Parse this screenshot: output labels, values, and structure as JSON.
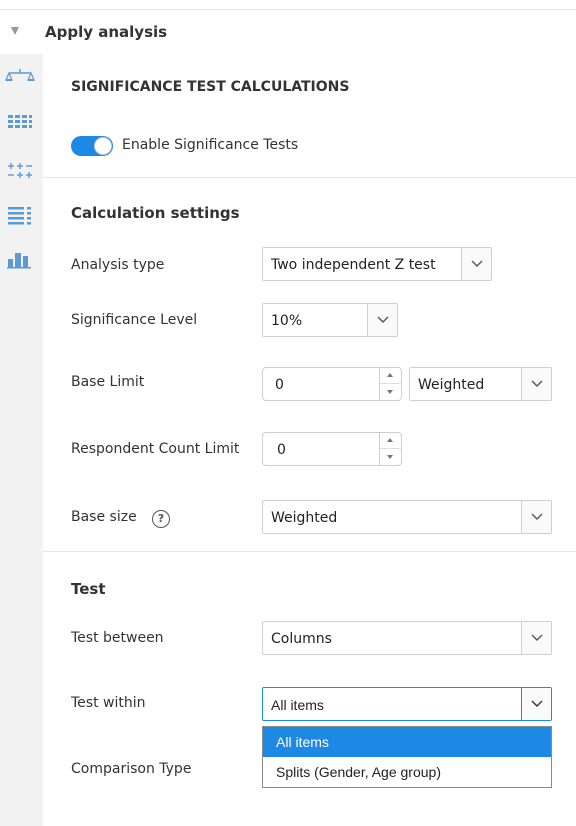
{
  "header": {
    "title": "Apply analysis"
  },
  "rail": {
    "icons": [
      "scale-icon",
      "grid-table-icon",
      "plus-minus-icon",
      "list-icon",
      "bar-chart-icon"
    ]
  },
  "panel": {
    "section_title": "SIGNIFICANCE TEST CALCULATIONS",
    "toggle": {
      "label": "Enable Significance Tests",
      "on": true
    },
    "calc": {
      "title": "Calculation settings",
      "analysis_type": {
        "label": "Analysis type",
        "value": "Two independent Z test"
      },
      "significance_level": {
        "label": "Significance Level",
        "value": "10%"
      },
      "base_limit": {
        "label": "Base Limit",
        "value": "0",
        "weight": "Weighted"
      },
      "respondent_count_limit": {
        "label": "Respondent Count Limit",
        "value": "0"
      },
      "base_size": {
        "label": "Base size",
        "help": "?",
        "value": "Weighted"
      }
    },
    "test": {
      "title": "Test",
      "test_between": {
        "label": "Test between",
        "value": "Columns"
      },
      "test_within": {
        "label": "Test within",
        "value": "All items",
        "options": [
          "All items",
          "Splits (Gender, Age group)"
        ],
        "selected_index": 0
      },
      "comparison_type": {
        "label": "Comparison Type"
      }
    }
  },
  "colors": {
    "accent": "#1e88e5",
    "rail_bg": "#f2f2f2",
    "rail_icon": "#5b9bd5"
  }
}
